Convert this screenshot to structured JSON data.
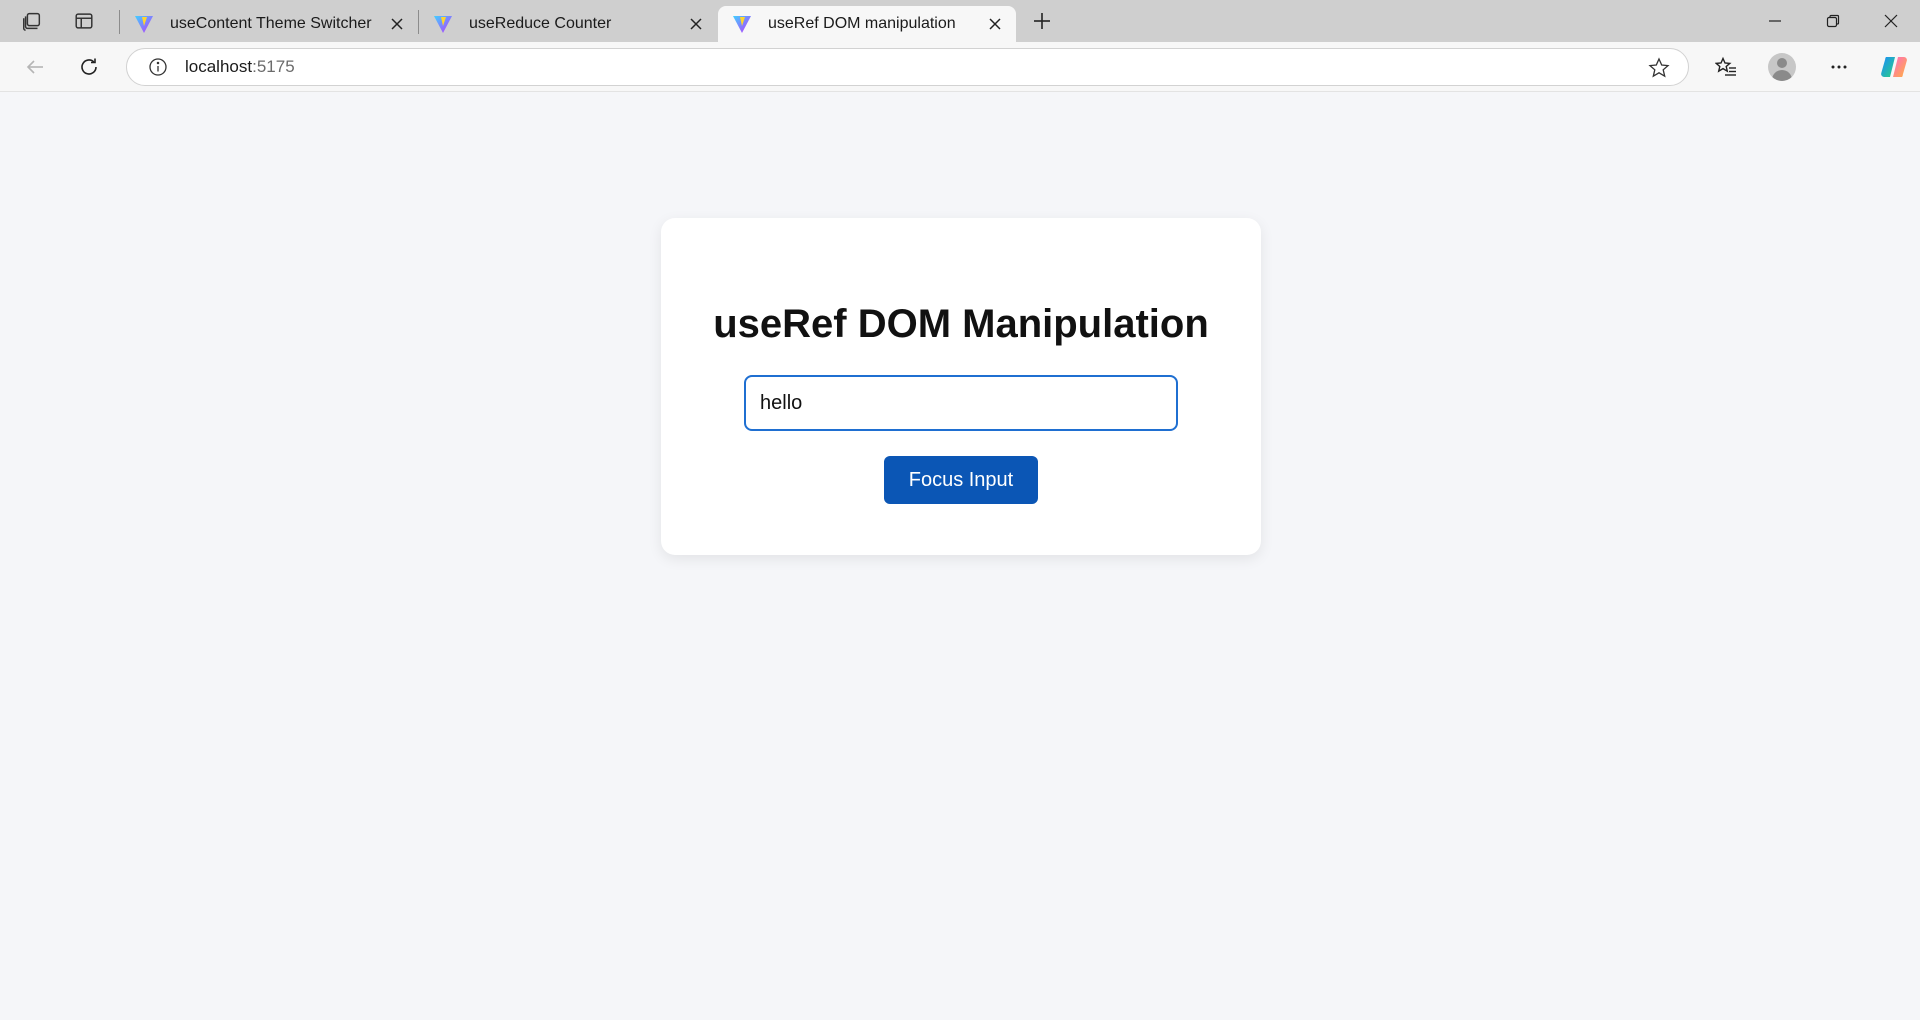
{
  "browser": {
    "tabs": [
      {
        "title": "useContent Theme Switcher",
        "active": false
      },
      {
        "title": "useReduce Counter",
        "active": false
      },
      {
        "title": "useRef DOM manipulation",
        "active": true
      }
    ],
    "address": {
      "host": "localhost",
      "port": ":5175"
    }
  },
  "page": {
    "heading": "useRef DOM Manipulation",
    "input_value": "hello",
    "button_label": "Focus Input"
  },
  "colors": {
    "accent": "#0b56b5",
    "input_border": "#1f6fd1",
    "page_bg": "#f5f6f9"
  }
}
